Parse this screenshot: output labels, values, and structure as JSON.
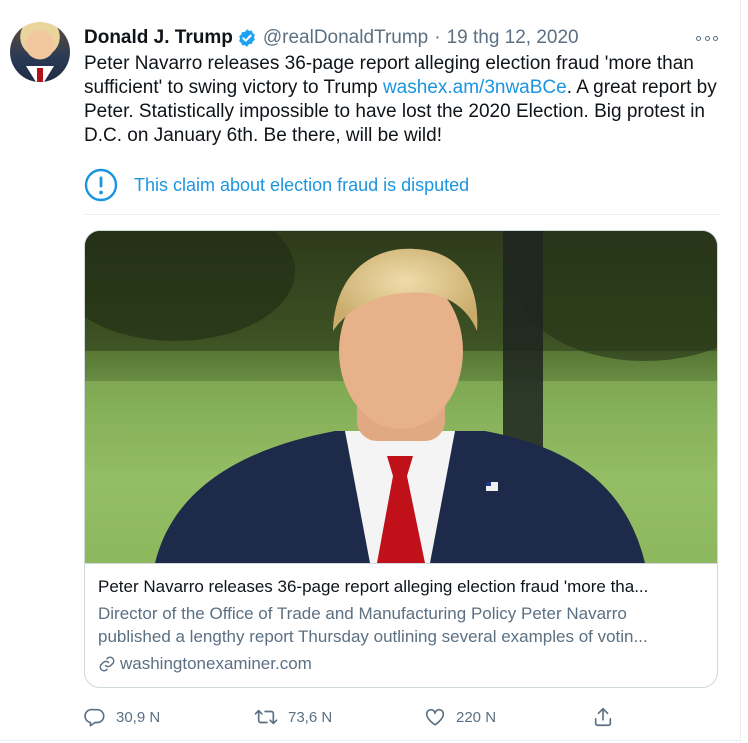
{
  "tweet": {
    "author_name": "Donald J. Trump",
    "handle": "@realDonaldTrump",
    "separator": "·",
    "date": "19 thg 12, 2020",
    "text_lines": [
      "Peter Navarro releases 36-page report alleging election fraud 'more than",
      "sufficient' to swing victory to Trump ",
      "Peter. Statistically impossible to have lost the 2020 Election. Big protest in",
      "D.C. on January 6th. Be there, will be wild!"
    ],
    "link_text": "washex.am/3nwaBCe",
    "text_after_link": ". A great report by",
    "notice": "This claim about election fraud is disputed"
  },
  "card": {
    "title": "Peter Navarro releases 36-page report alleging election fraud 'more tha...",
    "description_lines": [
      "Director of the Office of Trade and Manufacturing Policy Peter Navarro",
      "published a lengthy report Thursday outlining several examples of votin..."
    ],
    "domain": "washingtonexaminer.com"
  },
  "actions": {
    "replies": "30,9 N",
    "retweets": "73,6 N",
    "likes": "220 N"
  },
  "colors": {
    "link": "#1b95e0",
    "secondary_text": "#5b7083",
    "verified": "#1da1f2"
  },
  "icons": [
    "more-icon",
    "verified-icon",
    "info-icon",
    "link-icon",
    "reply-icon",
    "retweet-icon",
    "like-icon",
    "share-icon"
  ]
}
